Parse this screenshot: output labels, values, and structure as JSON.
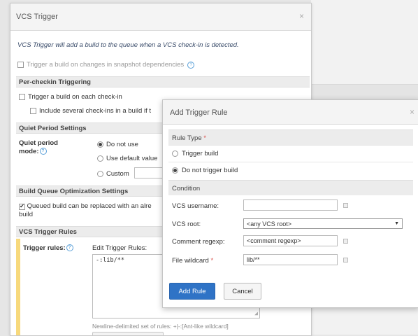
{
  "vcs_dialog": {
    "title": "VCS Trigger",
    "close": "×",
    "intro": "VCS Trigger will add a build to the queue when a VCS check-in is detected.",
    "snapshot_deps_label": "Trigger a build on changes in snapshot dependencies",
    "per_checkin": {
      "header": "Per-checkin Triggering",
      "each_checkin_label": "Trigger a build on each check-in",
      "several_checkins_label": "Include several check-ins in a build if t"
    },
    "quiet_period": {
      "header": "Quiet Period Settings",
      "label_line1": "Quiet period",
      "label_line2": "mode:",
      "options": [
        "Do not use",
        "Use default value",
        "Custom"
      ],
      "selected": 0
    },
    "queue_opt": {
      "header": "Build Queue Optimization Settings",
      "replace_label_line1": "Queued build can be replaced with an alre",
      "replace_label_line2": "build",
      "checked_mark": "✔"
    },
    "trigger_rules": {
      "header": "VCS Trigger Rules",
      "label": "Trigger rules:",
      "edit_label": "Edit Trigger Rules:",
      "value": "-:lib/**",
      "hint": "Newline-delimited set of rules: +|-:[Ant-like wildcard]"
    }
  },
  "add_rule_dialog": {
    "title": "Add Trigger Rule",
    "close": "×",
    "rule_type_header": "Rule Type",
    "required_mark": "*",
    "rule_options": [
      "Trigger build",
      "Do not trigger build"
    ],
    "selected_rule": 1,
    "condition_header": "Condition",
    "fields": {
      "username_label": "VCS username:",
      "username_value": "",
      "root_label": "VCS root:",
      "root_value": "<any VCS root>",
      "comment_label": "Comment regexp:",
      "comment_value": "<comment regexp>",
      "wildcard_label": "File wildcard",
      "wildcard_value": "lib/**"
    },
    "add_button": "Add Rule",
    "cancel_button": "Cancel"
  },
  "icons": {
    "help": "?",
    "dropdown": "▼",
    "resize": "◢"
  },
  "colors": {
    "primary": "#2f73c6",
    "required": "#d9534f",
    "highlight": "#f7d97c"
  }
}
